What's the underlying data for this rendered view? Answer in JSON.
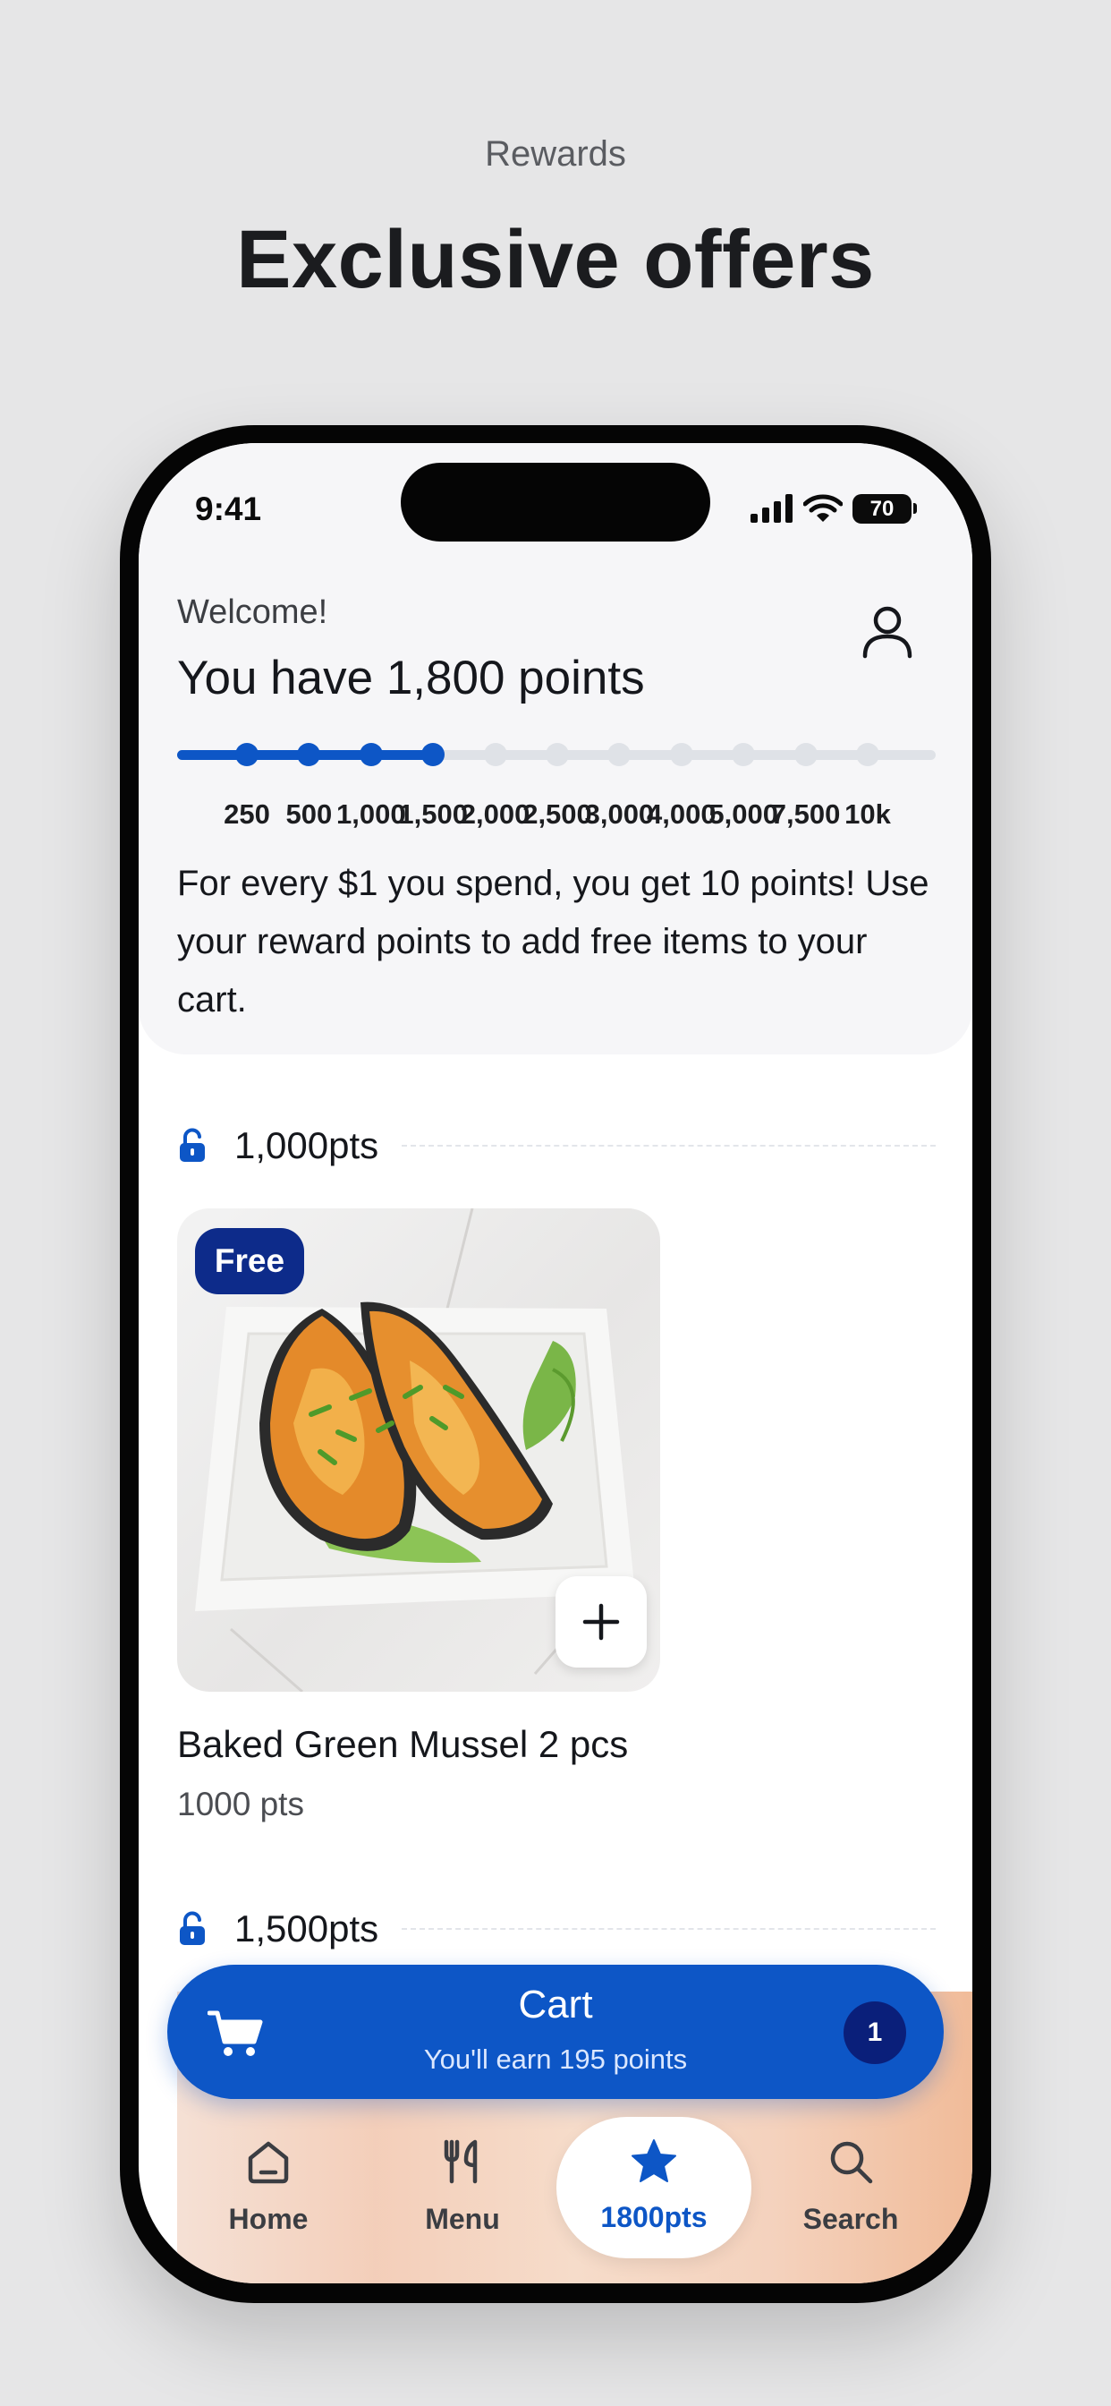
{
  "header": {
    "eyebrow": "Rewards",
    "title": "Exclusive offers"
  },
  "status_bar": {
    "time": "9:41",
    "battery": "70"
  },
  "rewards": {
    "greeting": "Welcome!",
    "points_headline": "You have 1,800 points",
    "current_points": 1800,
    "milestones": [
      "250",
      "500",
      "1,000",
      "1,500",
      "2,000",
      "2,500",
      "3,000",
      "4,000",
      "5,000",
      "7,500",
      "10k"
    ],
    "reached_count": 4,
    "info_text": "For every $1 you spend, you get 10 points! Use your reward points to add free items to your cart."
  },
  "tiers": [
    {
      "label": "1,000pts"
    },
    {
      "label": "1,500pts"
    }
  ],
  "items": [
    {
      "badge": "Free",
      "name": "Baked Green Mussel 2 pcs",
      "price": "1000 pts"
    }
  ],
  "cart": {
    "title": "Cart",
    "subtitle": "You'll earn 195 points",
    "count": "1"
  },
  "nav": [
    {
      "label": "Home",
      "icon": "home-icon"
    },
    {
      "label": "Menu",
      "icon": "fork-knife-icon"
    },
    {
      "label": "1800pts",
      "icon": "star-icon",
      "active": true
    },
    {
      "label": "Search",
      "icon": "search-icon"
    }
  ],
  "colors": {
    "accent": "#0d56c6",
    "badge": "#0d2b8a",
    "cart_count": "#0a1f7a"
  }
}
